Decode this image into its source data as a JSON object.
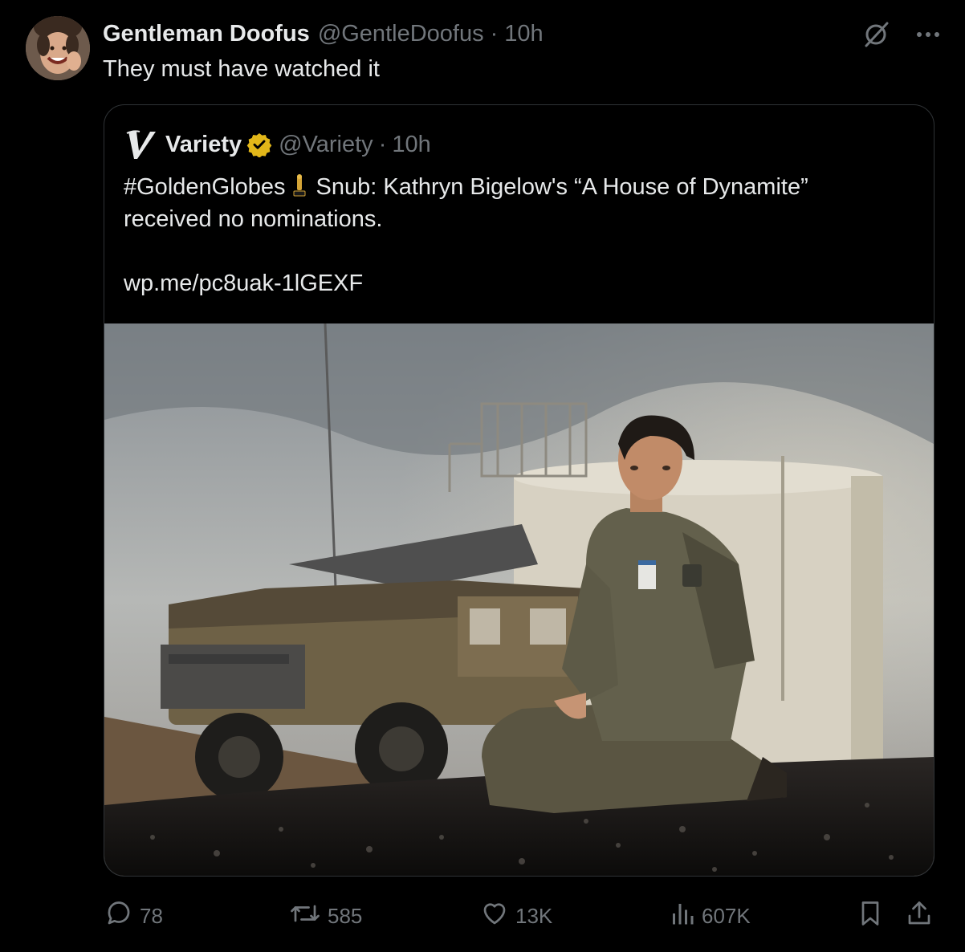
{
  "post": {
    "author_name": "Gentleman Doofus",
    "author_handle": "@GentleDoofus",
    "separator": "·",
    "time": "10h",
    "text": "They must have watched it"
  },
  "quoted": {
    "author_name": "Variety",
    "author_handle": "@Variety",
    "separator": "·",
    "time": "10h",
    "hashtag": "#GoldenGlobes",
    "text_rest": "Snub: Kathryn Bigelow's “A House of Dynamite”",
    "text_line2": "received no nominations.",
    "link": "wp.me/pc8uak-1lGEXF"
  },
  "actions": {
    "replies": "78",
    "reposts": "585",
    "likes": "13K",
    "views": "607K"
  },
  "icons": [
    "grok-icon",
    "more-icon",
    "variety-logo",
    "verified-badge",
    "trophy-emoji",
    "reply-icon",
    "repost-icon",
    "like-icon",
    "views-icon",
    "bookmark-icon",
    "share-icon"
  ],
  "colors": {
    "background": "#000000",
    "text": "#e7e9ea",
    "secondary": "#71767b",
    "border": "#2f3336",
    "verified_gold": "#e2b719"
  }
}
